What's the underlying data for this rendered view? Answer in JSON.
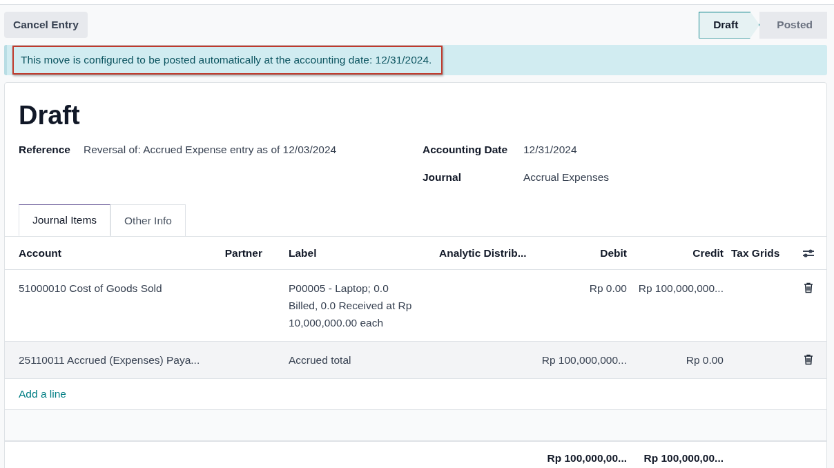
{
  "toolbar": {
    "cancel_button": "Cancel Entry",
    "status_steps": [
      {
        "label": "Draft",
        "selected": true
      },
      {
        "label": "Posted",
        "selected": false
      }
    ]
  },
  "alert": "This move is configured to be posted automatically at the accounting date: 12/31/2024.",
  "form": {
    "title": "Draft",
    "fields_left": [
      {
        "label": "Reference",
        "value": "Reversal of: Accrued Expense entry as of 12/03/2024"
      }
    ],
    "fields_right": [
      {
        "label": "Accounting Date",
        "value": "12/31/2024"
      },
      {
        "label": "Journal",
        "value": "Accrual Expenses"
      }
    ],
    "tabs": [
      {
        "label": "Journal Items",
        "selected": true
      },
      {
        "label": "Other Info",
        "selected": false
      }
    ],
    "table": {
      "columns": [
        "Account",
        "Partner",
        "Label",
        "Analytic Distrib...",
        "Debit",
        "Credit",
        "Tax Grids"
      ],
      "rows": [
        {
          "account": "51000010 Cost of Goods Sold",
          "label": "P00005 - Laptop; 0.0 Billed, 0.0 Received at Rp 10,000,000.00 each",
          "debit": "Rp 0.00",
          "credit": "Rp 100,000,000...",
          "hovered": false
        },
        {
          "account": "25110011 Accrued (Expenses) Paya...",
          "label": "Accrued total",
          "debit": "Rp 100,000,000...",
          "credit": "Rp 0.00",
          "hovered": true
        }
      ],
      "add_line": "Add a line",
      "totals": {
        "debit": "Rp 100,000,00...",
        "credit": "Rp 100,000,00..."
      }
    }
  }
}
